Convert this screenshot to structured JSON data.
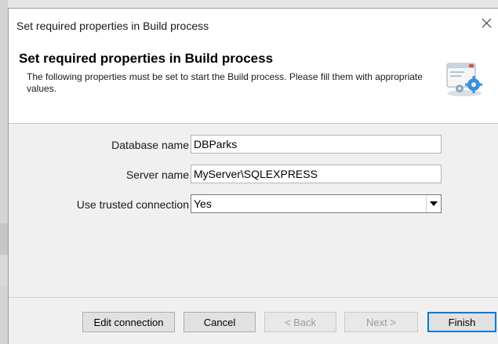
{
  "window": {
    "title": "Set required properties in Build process",
    "close_icon": "close-icon"
  },
  "header": {
    "title": "Set required properties in Build process",
    "description": "The following properties must be set to start the Build process. Please fill them with appropriate values.",
    "icon": "wizard-settings-icon"
  },
  "form": {
    "database_name": {
      "label": "Database name",
      "value": "DBParks"
    },
    "server_name": {
      "label": "Server name",
      "value": "MyServer\\SQLEXPRESS"
    },
    "trusted_connection": {
      "label": "Use trusted connection",
      "selected": "Yes",
      "icon": "chevron-down-icon"
    }
  },
  "buttons": {
    "edit_connection": "Edit connection",
    "cancel": "Cancel",
    "back": "< Back",
    "next": "Next >",
    "finish": "Finish"
  },
  "colors": {
    "accent": "#0078d7",
    "dialog_bg": "#f0f0f0",
    "header_bg": "#ffffff"
  }
}
